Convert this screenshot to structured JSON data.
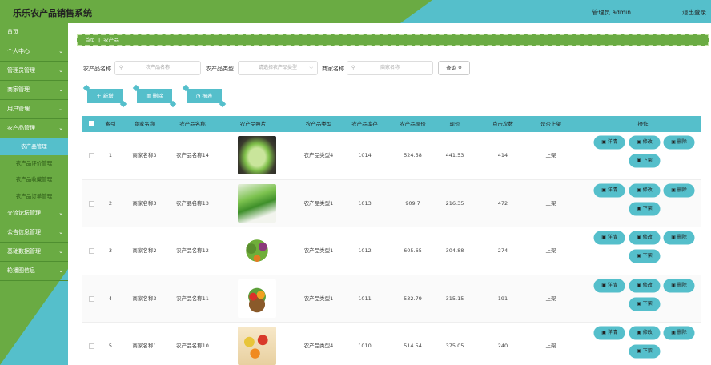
{
  "header": {
    "title": "乐乐农产品销售系统",
    "user": "管理员 admin",
    "logout": "退出登录"
  },
  "sidebar": {
    "items": [
      {
        "label": "首页",
        "has_chevron": false
      },
      {
        "label": "个人中心",
        "has_chevron": true
      },
      {
        "label": "管理员管理",
        "has_chevron": true
      },
      {
        "label": "商家管理",
        "has_chevron": true
      },
      {
        "label": "用户管理",
        "has_chevron": true
      },
      {
        "label": "农产品管理",
        "has_chevron": true
      }
    ],
    "sub_items": [
      {
        "label": "农产品管理",
        "active": true
      },
      {
        "label": "农产品评价管理",
        "active": false
      },
      {
        "label": "农产品收藏管理",
        "active": false
      },
      {
        "label": "农产品订单管理",
        "active": false
      }
    ],
    "items_after": [
      {
        "label": "交流论坛管理",
        "has_chevron": true
      },
      {
        "label": "公告信息管理",
        "has_chevron": true
      },
      {
        "label": "基础数据管理",
        "has_chevron": true
      },
      {
        "label": "轮播图信息",
        "has_chevron": true
      }
    ]
  },
  "breadcrumb": {
    "home": "首页",
    "current": "农产品"
  },
  "search": {
    "name_label": "农产品名称",
    "name_placeholder": "农产品名称",
    "type_label": "农产品类型",
    "type_placeholder": "请选择农产品类型",
    "merchant_label": "商家名称",
    "merchant_placeholder": "商家名称",
    "query_button": "查询"
  },
  "actions": {
    "add": "新增",
    "delete": "删除",
    "report": "报表"
  },
  "table": {
    "columns": [
      "索引",
      "商家名称",
      "农产品名称",
      "农产品照片",
      "农产品类型",
      "农产品库存",
      "农产品原价",
      "现价",
      "点击次数",
      "是否上架",
      "操作"
    ],
    "rows": [
      {
        "index": "1",
        "merchant": "商家名称3",
        "name": "农产品名称14",
        "image": "napa-cabbage",
        "type": "农产品类型4",
        "stock": "1014",
        "orig_price": "524.58",
        "price": "441.53",
        "clicks": "414",
        "status": "上架"
      },
      {
        "index": "2",
        "merchant": "商家名称3",
        "name": "农产品名称13",
        "image": "bok-choy",
        "type": "农产品类型1",
        "stock": "1013",
        "orig_price": "909.7",
        "price": "216.35",
        "clicks": "472",
        "status": "上架"
      },
      {
        "index": "3",
        "merchant": "商家名称2",
        "name": "农产品名称12",
        "image": "mixed-vegetables",
        "type": "农产品类型1",
        "stock": "1012",
        "orig_price": "605.65",
        "price": "304.88",
        "clicks": "274",
        "status": "上架"
      },
      {
        "index": "4",
        "merchant": "商家名称3",
        "name": "农产品名称11",
        "image": "fruit-basket",
        "type": "农产品类型1",
        "stock": "1011",
        "orig_price": "532.79",
        "price": "315.15",
        "clicks": "191",
        "status": "上架"
      },
      {
        "index": "5",
        "merchant": "商家名称1",
        "name": "农产品名称10",
        "image": "assorted-fruits",
        "type": "农产品类型4",
        "stock": "1010",
        "orig_price": "514.54",
        "price": "375.05",
        "clicks": "240",
        "status": "上架"
      }
    ],
    "row_buttons": {
      "detail": "详情",
      "edit": "修改",
      "delete": "删除",
      "off_shelf": "下架"
    }
  },
  "colors": {
    "green": "#6aab43",
    "teal": "#55bfcb"
  }
}
